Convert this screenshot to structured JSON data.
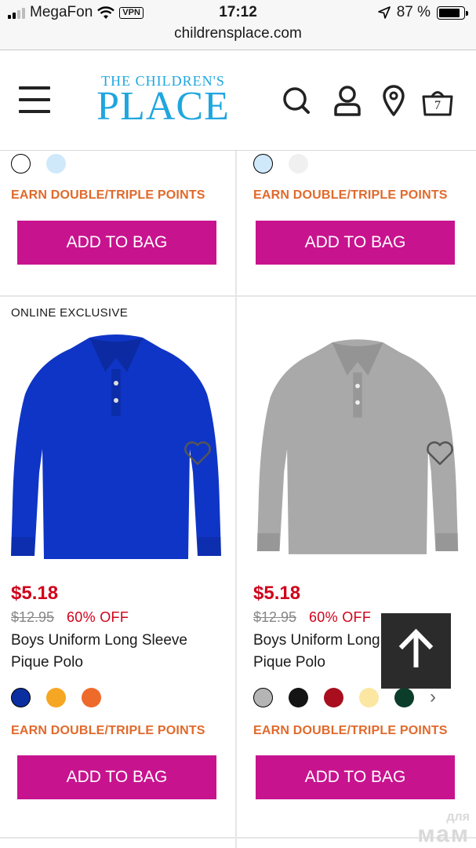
{
  "status_bar": {
    "carrier": "MegaFon",
    "vpn": "VPN",
    "time": "17:12",
    "battery": "87 %",
    "battery_level": 0.87
  },
  "browser": {
    "url": "childrensplace.com"
  },
  "header": {
    "logo_top": "THE CHILDREN'S",
    "logo_main": "PLACE",
    "cart_count": "7",
    "icons": [
      "menu-icon",
      "search-icon",
      "account-icon",
      "location-pin-icon",
      "shopping-bag-icon"
    ]
  },
  "products_top": [
    {
      "swatches": [
        "#ffffff",
        "#cfe9fb"
      ],
      "points": "EARN DOUBLE/TRIPLE POINTS",
      "button": "ADD TO BAG"
    },
    {
      "swatches": [
        "#cfe9fb",
        "#f0f0f0"
      ],
      "points": "EARN DOUBLE/TRIPLE POINTS",
      "button": "ADD TO BAG"
    }
  ],
  "products": [
    {
      "badge": "ONLINE EXCLUSIVE",
      "shirt_color": "#0f35c7",
      "price": "$5.18",
      "original_price": "$12.95",
      "discount": "60% OFF",
      "name": "Boys Uniform Long Sleeve Pique Polo",
      "swatches": [
        "#0b2fa0",
        "#f5a623",
        "#ee6a2b"
      ],
      "points": "EARN DOUBLE/TRIPLE POINTS",
      "button": "ADD TO BAG"
    },
    {
      "badge": "",
      "shirt_color": "#a9a9a9",
      "price": "$5.18",
      "original_price": "$12.95",
      "discount": "60% OFF",
      "name": "Boys Uniform Long Sleeve Pique Polo",
      "swatches": [
        "#b5b5b5",
        "#141414",
        "#a80e1e",
        "#fbe7a1",
        "#0b3d2a"
      ],
      "points": "EARN DOUBLE/TRIPLE POINTS",
      "button": "ADD TO BAG"
    }
  ],
  "colors": {
    "accent": "#c8138f",
    "points": "#e1692b",
    "price": "#d0021b",
    "logo": "#1fa6df"
  },
  "watermark": {
    "top": "для",
    "bottom": "мам"
  }
}
